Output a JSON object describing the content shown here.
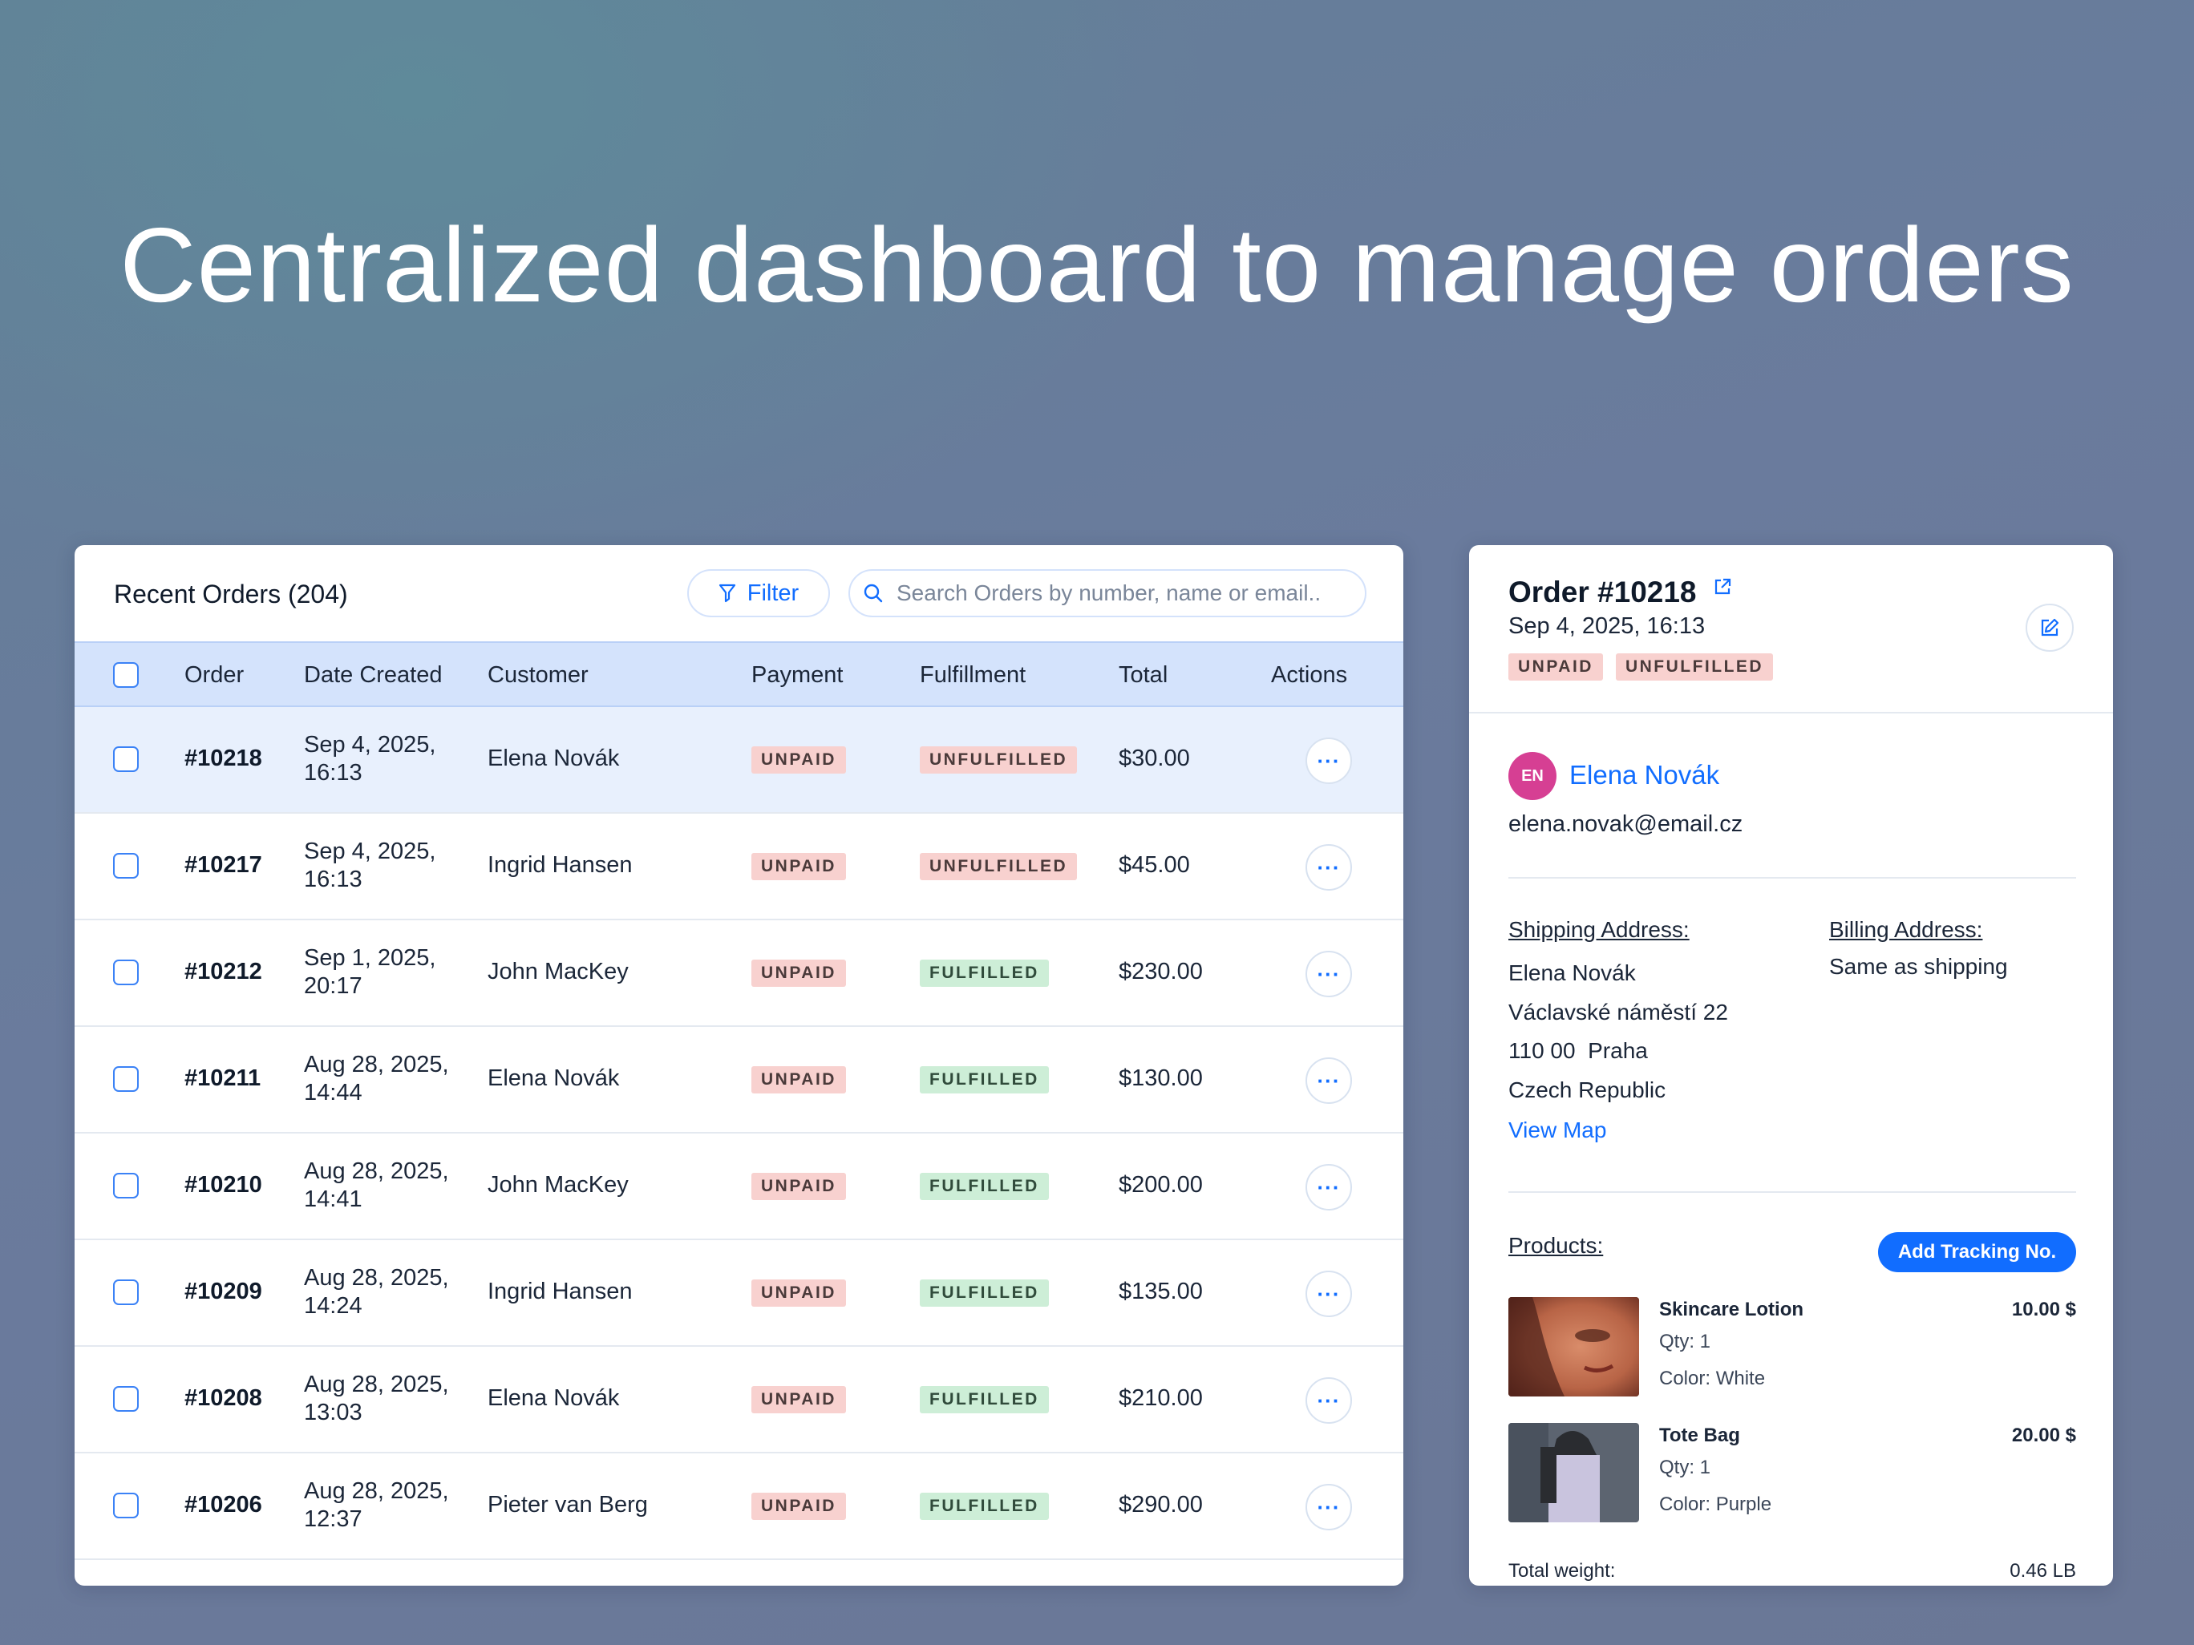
{
  "hero": {
    "title": "Centralized dashboard to manage orders"
  },
  "orders": {
    "title": "Recent Orders (204)",
    "filter_label": "Filter",
    "search_placeholder": "Search Orders by number, name or email..",
    "columns": [
      "Order",
      "Date Created",
      "Customer",
      "Payment",
      "Fulfillment",
      "Total",
      "Actions"
    ],
    "rows": [
      {
        "order": "#10218",
        "date1": "Sep 4, 2025,",
        "date2": "16:13",
        "customer": "Elena Novák",
        "payment": "UNPAID",
        "fulfillment": "UNFULFILLED",
        "total": "$30.00",
        "selected": true
      },
      {
        "order": "#10217",
        "date1": "Sep 4, 2025,",
        "date2": "16:13",
        "customer": "Ingrid Hansen",
        "payment": "UNPAID",
        "fulfillment": "UNFULFILLED",
        "total": "$45.00"
      },
      {
        "order": "#10212",
        "date1": "Sep 1, 2025,",
        "date2": "20:17",
        "customer": "John MacKey",
        "payment": "UNPAID",
        "fulfillment": "FULFILLED",
        "total": "$230.00"
      },
      {
        "order": "#10211",
        "date1": "Aug 28, 2025,",
        "date2": "14:44",
        "customer": "Elena Novák",
        "payment": "UNPAID",
        "fulfillment": "FULFILLED",
        "total": "$130.00"
      },
      {
        "order": "#10210",
        "date1": "Aug 28, 2025,",
        "date2": "14:41",
        "customer": "John MacKey",
        "payment": "UNPAID",
        "fulfillment": "FULFILLED",
        "total": "$200.00"
      },
      {
        "order": "#10209",
        "date1": "Aug 28, 2025,",
        "date2": "14:24",
        "customer": "Ingrid Hansen",
        "payment": "UNPAID",
        "fulfillment": "FULFILLED",
        "total": "$135.00"
      },
      {
        "order": "#10208",
        "date1": "Aug 28, 2025,",
        "date2": "13:03",
        "customer": "Elena Novák",
        "payment": "UNPAID",
        "fulfillment": "FULFILLED",
        "total": "$210.00"
      },
      {
        "order": "#10206",
        "date1": "Aug 28, 2025,",
        "date2": "12:37",
        "customer": "Pieter van Berg",
        "payment": "UNPAID",
        "fulfillment": "FULFILLED",
        "total": "$290.00"
      }
    ],
    "actions_glyph": "···"
  },
  "detail": {
    "title": "Order #10218",
    "date": "Sep 4, 2025, 16:13",
    "payment_badge": "UNPAID",
    "fulfillment_badge": "UNFULFILLED",
    "customer": {
      "initials": "EN",
      "name": "Elena Novák",
      "email": "elena.novak@email.cz"
    },
    "shipping": {
      "label": "Shipping Address:",
      "lines": [
        "Elena Novák",
        "Václavské náměstí 22",
        "110 00  Praha",
        "Czech Republic"
      ]
    },
    "billing": {
      "label": "Billing Address:",
      "value": "Same as shipping"
    },
    "view_map": "View Map",
    "products_label": "Products:",
    "tracking_button": "Add Tracking No.",
    "products": [
      {
        "name": "Skincare Lotion",
        "qty": "Qty: 1",
        "color": "Color: White",
        "price": "10.00 $"
      },
      {
        "name": "Tote Bag",
        "qty": "Qty: 1",
        "color": "Color: Purple",
        "price": "20.00 $"
      }
    ],
    "total_weight_label": "Total weight:",
    "total_weight_value": "0.46 LB"
  },
  "colors": {
    "accent": "#116dff",
    "unpaid_bg": "#f8d1cf",
    "fulfilled_bg": "#cdeed7",
    "avatar": "#d63f93",
    "header_bg": "#d4e3fc"
  },
  "icons": [
    "filter-icon",
    "search-icon",
    "external-link-icon",
    "edit-icon",
    "more-icon"
  ]
}
